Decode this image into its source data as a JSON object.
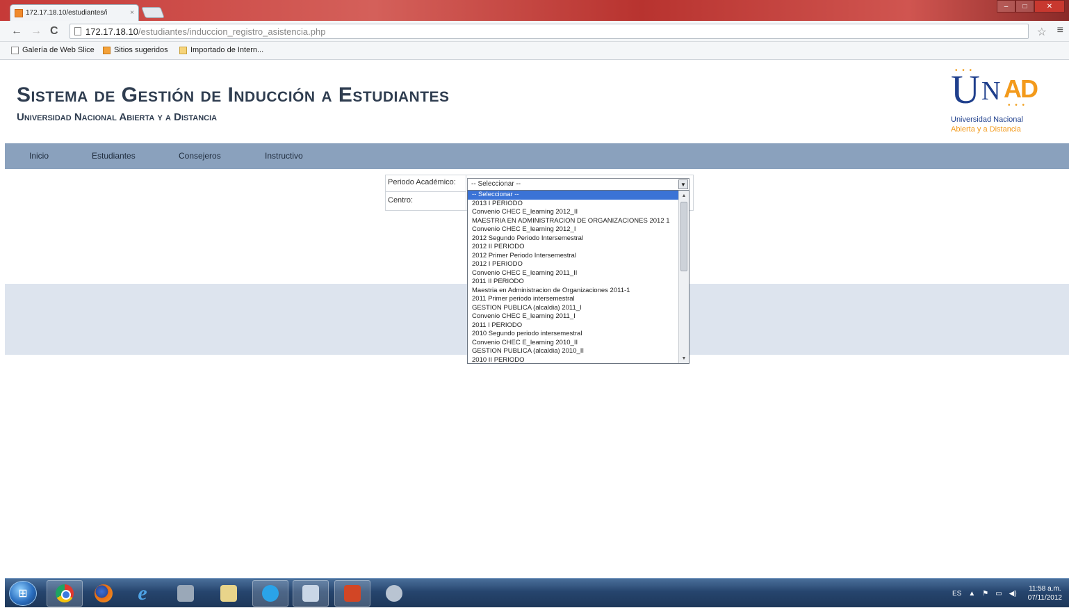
{
  "browser": {
    "tab_title": "172.17.18.10/estudiantes/i",
    "tab_close": "×",
    "url_host": "172.17.18.10",
    "url_path": "/estudiantes/induccion_registro_asistencia.php",
    "bookmarks": [
      "Galería de Web Slice",
      "Sitios sugeridos",
      "Importado de Intern..."
    ]
  },
  "header": {
    "title": "Sistema de Gestión de Inducción a Estudiantes",
    "subtitle": "Universidad Nacional Abierta y a Distancia"
  },
  "logo": {
    "text_u": "U",
    "text_n": "N",
    "text_ad": "AD",
    "line1": "Universidad Nacional",
    "line2": "Abierta y a  Distancia"
  },
  "nav": {
    "items": [
      "Inicio",
      "Estudiantes",
      "Consejeros",
      "Instructivo"
    ]
  },
  "form": {
    "periodo_label": "Periodo Académico:",
    "centro_label": "Centro:",
    "select_value": "-- Seleccionar --",
    "options": [
      "-- Seleccionar --",
      "2013 I PERIODO",
      "Convenio CHEC E_learning 2012_II",
      "MAESTRIA EN ADMINISTRACION DE ORGANIZACIONES 2012 1",
      "Convenio CHEC E_learning 2012_I",
      "2012 Segundo Periodo Intersemestral",
      "2012 II PERIODO",
      "2012 Primer Periodo Intersemestral",
      "2012 I PERIODO",
      "Convenio CHEC E_learning 2011_II",
      "2011 II PERIODO",
      "Maestria en Administracion de Organizaciones 2011-1",
      "2011 Primer periodo intersemestral",
      "GESTION PUBLICA (alcaldia) 2011_I",
      "Convenio CHEC E_learning 2011_I",
      "2011 I PERIODO",
      "2010 Segundo periodo intersemestral",
      "Convenio CHEC E_learning 2010_II",
      "GESTION PUBLICA (alcaldia) 2010_II",
      "2010 II PERIODO"
    ],
    "selected_index": 0
  },
  "taskbar": {
    "lang": "ES",
    "time": "11:58 a.m.",
    "date": "07/11/2012"
  }
}
